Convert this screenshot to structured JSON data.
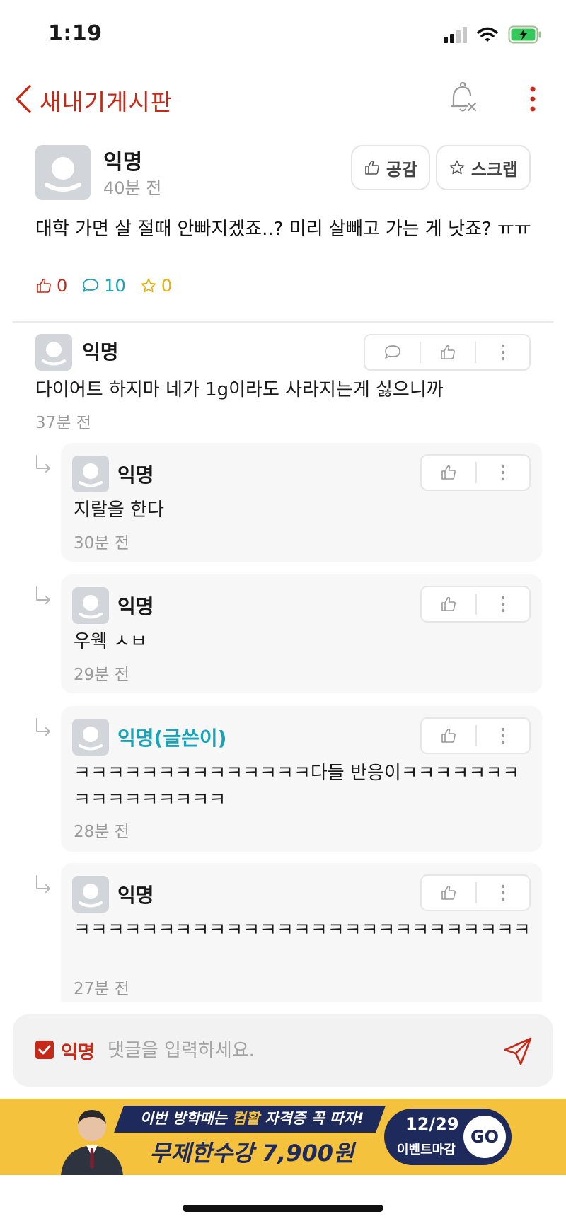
{
  "status_bar": {
    "time": "1:19"
  },
  "header": {
    "title": "새내기게시판"
  },
  "post": {
    "author": "익명",
    "time": "40분 전",
    "like_label": "공감",
    "scrap_label": "스크랩",
    "body": "대학 가면 살 절때 안빠지겠죠..? 미리 살빼고 가는 게 낫죠? ㅠㅠ",
    "likes": "0",
    "comments": "10",
    "scraps": "0"
  },
  "comment": {
    "author": "익명",
    "body": "다이어트 하지마 네가 1g이라도 사라지는게 싫으니까",
    "time": "37분 전"
  },
  "replies": [
    {
      "author": "익명",
      "body": "지랄을 한다",
      "time": "30분 전"
    },
    {
      "author": "익명",
      "body": "우웩 ㅅㅂ",
      "time": "29분 전"
    },
    {
      "author": "익명(글쓴이)",
      "body": "ㅋㅋㅋㅋㅋㅋㅋㅋㅋㅋㅋㅋㅋㅋ다들 반응이ㅋㅋㅋㅋㅋㅋㅋㅋㅋㅋㅋㅋㅋㅋㅋㅋ",
      "time": "28분 전"
    },
    {
      "author": "익명",
      "body": "ㅋㅋㅋㅋㅋㅋㅋㅋㅋㅋㅋㅋㅋㅋㅋㅋㅋㅋㅋㅋㅋㅋㅋㅋㅋㅋㅋ",
      "time": "27분 전"
    }
  ],
  "composer": {
    "anonymous_label": "익명",
    "anonymous_checked": true,
    "placeholder": "댓글을 입력하세요."
  },
  "ad": {
    "line1_prefix": "이번 방학때는 ",
    "line1_highlight": "컴활",
    "line1_suffix": " 자격증 꼭 따자!",
    "line2": "무제한수강 7,900원",
    "date": "12/29",
    "deadline_label": "이벤트마감",
    "go_label": "GO"
  },
  "colors": {
    "accent": "#c62917",
    "comment_accent": "#19a3b8",
    "scrap_accent": "#e8b000",
    "ad_background": "#f5c23d",
    "ad_navy": "#1f2a5c"
  },
  "icons": [
    "chevron-left-icon",
    "bell-off-icon",
    "more-vertical-icon",
    "thumbs-up-icon",
    "star-icon",
    "speech-bubble-icon",
    "reply-arrow-icon",
    "checkbox-icon",
    "send-icon",
    "wifi-icon",
    "battery-charging-icon"
  ]
}
